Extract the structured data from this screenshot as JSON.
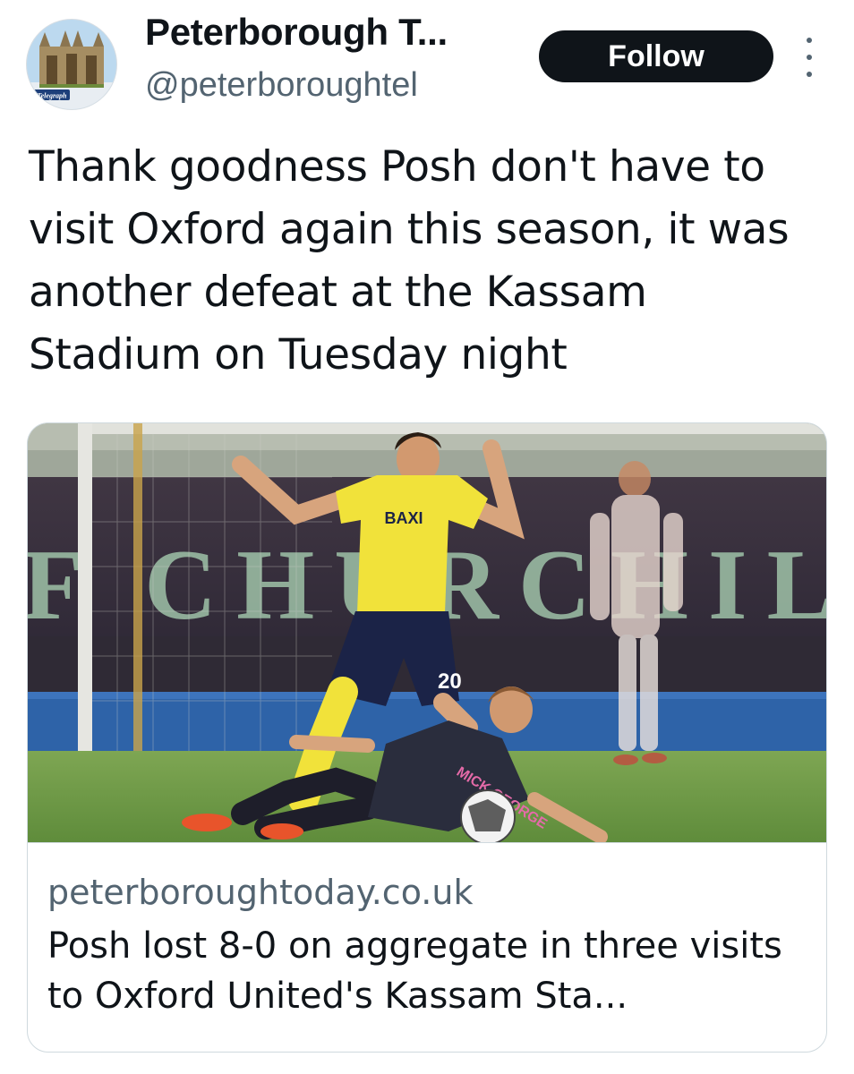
{
  "account": {
    "display_name": "Peterborough T...",
    "handle": "@peterboroughtel",
    "avatar_label": "Telegraph"
  },
  "actions": {
    "follow_label": "Follow"
  },
  "tweet": {
    "text": "Thank goodness Posh don't have to visit Oxford again this season, it was another defeat at the Kassam Stadium on Tuesday night"
  },
  "link_card": {
    "domain": "peterboroughtoday.co.uk",
    "title": "Posh lost 8-0 on aggregate in three visits to Oxford United's Kassam Sta...",
    "image": {
      "board_text": "F CHURCHILL",
      "sponsor_text": "BAXI",
      "shirt_number": "20",
      "opponent_sponsor": "MICK GEORGE"
    }
  },
  "colors": {
    "follow_bg": "#0f1419",
    "secondary_text": "#536471",
    "card_border": "#cfd9de",
    "oxford_yellow": "#f1e23a",
    "oxford_navy": "#1b2347",
    "pitch_green": "#6f9a47"
  },
  "icons": {
    "more": "vertical-ellipsis-icon"
  }
}
